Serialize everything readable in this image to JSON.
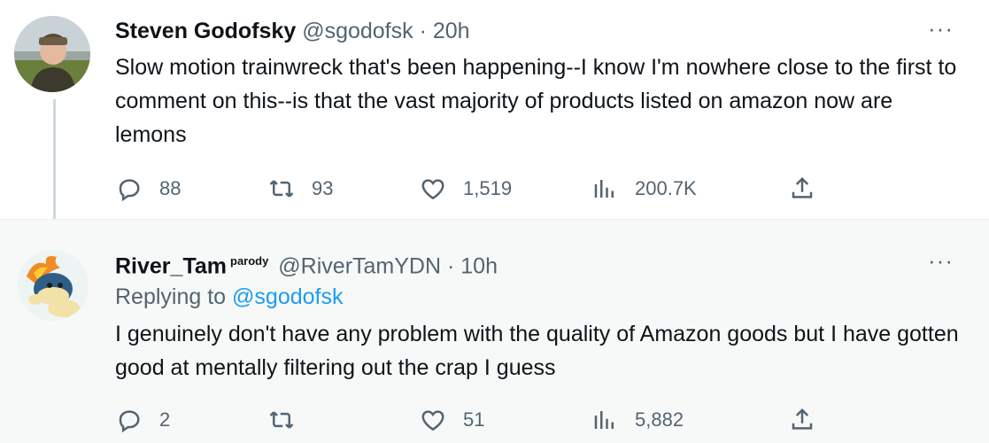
{
  "tweets": [
    {
      "name": "Steven Godofsky",
      "handle": "@sgodofsk",
      "separator": "·",
      "time": "20h",
      "text": "Slow motion trainwreck that's been happening--I know I'm nowhere close to the first to comment on this--is that the vast majority of products listed on amazon now are lemons",
      "more": "···",
      "metrics": {
        "replies": "88",
        "retweets": "93",
        "likes": "1,519",
        "views": "200.7K"
      }
    },
    {
      "name": "River_Tam",
      "badge": "parody",
      "handle": "@RiverTamYDN",
      "separator": "·",
      "time": "10h",
      "replying_prefix": "Replying to",
      "replying_handle": "@sgodofsk",
      "text": "I genuinely don't have any problem with the quality of Amazon goods but I have gotten good at mentally filtering out the crap I guess",
      "more": "···",
      "metrics": {
        "replies": "2",
        "retweets": "",
        "likes": "51",
        "views": "5,882"
      }
    }
  ],
  "icons": {
    "reply": "speech-bubble-icon",
    "retweet": "retweet-arrows-icon",
    "like": "heart-icon",
    "views": "bar-chart-icon",
    "share": "share-upload-icon",
    "more": "ellipsis-icon"
  },
  "colors": {
    "accent": "#1d9bf0",
    "muted": "#536471",
    "text": "#0f1419",
    "reply_bg": "#f7f9f9"
  }
}
